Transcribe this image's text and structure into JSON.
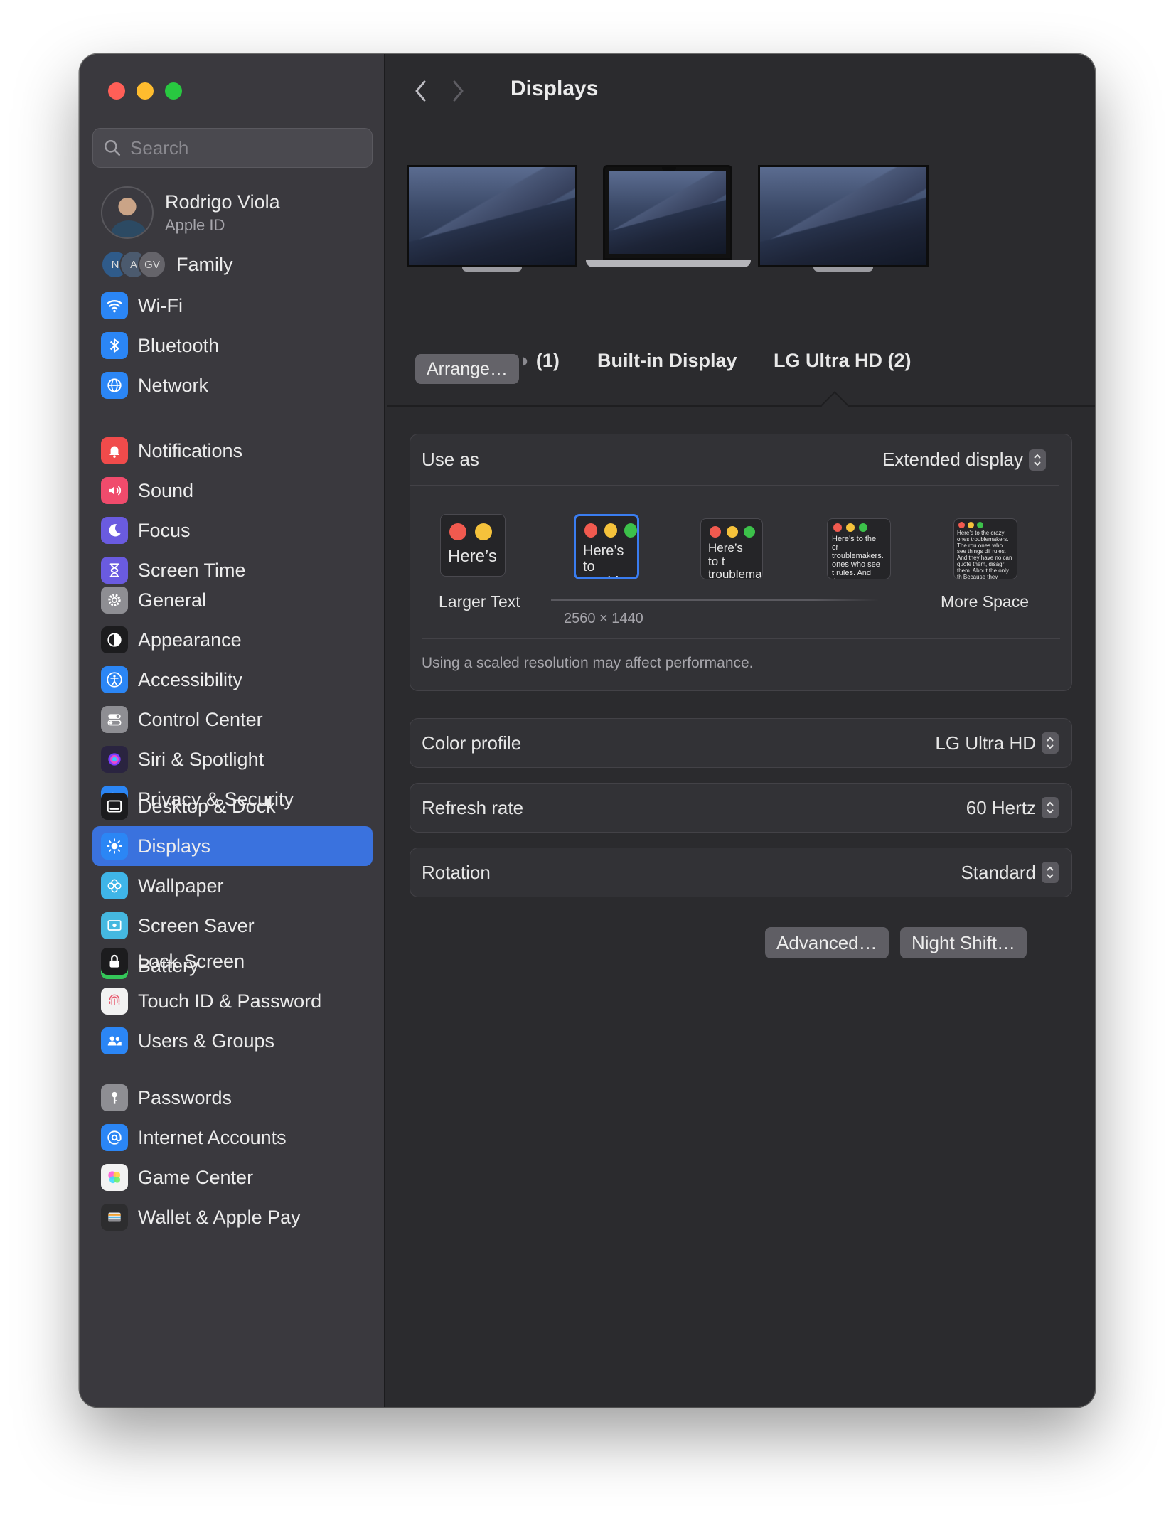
{
  "window": {
    "title": "Displays"
  },
  "search": {
    "placeholder": "Search"
  },
  "profile": {
    "name": "Rodrigo Viola",
    "subtitle": "Apple ID"
  },
  "family": {
    "label": "Family",
    "avatars": [
      "N",
      "A",
      "GV"
    ]
  },
  "sidebar": {
    "groups": [
      [
        {
          "label": "Wi-Fi",
          "icon": "wifi-icon",
          "color": "#2b86f5"
        },
        {
          "label": "Bluetooth",
          "icon": "bluetooth-icon",
          "color": "#2b86f5"
        },
        {
          "label": "Network",
          "icon": "globe-icon",
          "color": "#2b86f5"
        }
      ],
      [
        {
          "label": "Notifications",
          "icon": "bell-icon",
          "color": "#f04b4b"
        },
        {
          "label": "Sound",
          "icon": "speaker-icon",
          "color": "#f04b6c"
        },
        {
          "label": "Focus",
          "icon": "moon-icon",
          "color": "#6a5be0"
        },
        {
          "label": "Screen Time",
          "icon": "hourglass-icon",
          "color": "#6a5be0"
        }
      ],
      [
        {
          "label": "General",
          "icon": "gear-icon",
          "color": "#8e8e93"
        },
        {
          "label": "Appearance",
          "icon": "appearance-icon",
          "color": "#1c1c1e"
        },
        {
          "label": "Accessibility",
          "icon": "accessibility-icon",
          "color": "#2b86f5"
        },
        {
          "label": "Control Center",
          "icon": "switches-icon",
          "color": "#8e8e93"
        },
        {
          "label": "Siri & Spotlight",
          "icon": "siri-icon",
          "color": "#2a2440"
        },
        {
          "label": "Privacy & Security",
          "icon": "hand-icon",
          "color": "#2b86f5"
        }
      ],
      [
        {
          "label": "Desktop & Dock",
          "icon": "dock-icon",
          "color": "#1c1c1e"
        },
        {
          "label": "Displays",
          "icon": "sun-icon",
          "color": "#2b86f5",
          "active": true
        },
        {
          "label": "Wallpaper",
          "icon": "flower-icon",
          "color": "#3fb5e8"
        },
        {
          "label": "Screen Saver",
          "icon": "screensaver-icon",
          "color": "#45b8e0"
        },
        {
          "label": "Battery",
          "icon": "battery-icon",
          "color": "#34c759"
        }
      ],
      [
        {
          "label": "Lock Screen",
          "icon": "lock-icon",
          "color": "#1c1c1e"
        },
        {
          "label": "Touch ID & Password",
          "icon": "fingerprint-icon",
          "color": "#f2f2f2"
        },
        {
          "label": "Users & Groups",
          "icon": "users-icon",
          "color": "#2b86f5"
        }
      ],
      [
        {
          "label": "Passwords",
          "icon": "key-icon",
          "color": "#8e8e93"
        },
        {
          "label": "Internet Accounts",
          "icon": "at-icon",
          "color": "#2b86f5"
        },
        {
          "label": "Game Center",
          "icon": "gamecenter-icon",
          "color": "#f2f2f2"
        },
        {
          "label": "Wallet & Apple Pay",
          "icon": "wallet-icon",
          "color": "#2d2d2f"
        }
      ]
    ]
  },
  "displays": {
    "arrange_label": "Arrange…",
    "monitors": [
      {
        "caption": "(1)",
        "caption_prefix": "◗"
      },
      {
        "caption": "Built-in Display"
      },
      {
        "caption": "LG Ultra HD (2)"
      }
    ]
  },
  "use_as": {
    "label": "Use as",
    "value": "Extended display"
  },
  "resolution": {
    "options": [
      {
        "text": "Here’s",
        "caption": "Larger Text"
      },
      {
        "text": "Here’s to troublem",
        "caption": "2560 × 1440",
        "selected": true
      },
      {
        "text": "Here’s to t troublema ones who",
        "caption": ""
      },
      {
        "text": "Here’s to the cr troublemakers. ones who see t rules. And they",
        "caption": ""
      },
      {
        "text": "Here’s to the crazy ones troublemakers. The rou ones who see things dif rules. And they have no can quote them, disagr them. About the only th Because they change th",
        "caption": "More Space"
      }
    ],
    "note": "Using a scaled resolution may affect performance."
  },
  "color_profile": {
    "label": "Color profile",
    "value": "LG Ultra HD"
  },
  "refresh_rate": {
    "label": "Refresh rate",
    "value": "60 Hertz"
  },
  "rotation": {
    "label": "Rotation",
    "value": "Standard"
  },
  "buttons": {
    "advanced": "Advanced…",
    "night_shift": "Night Shift…",
    "help": "?"
  }
}
